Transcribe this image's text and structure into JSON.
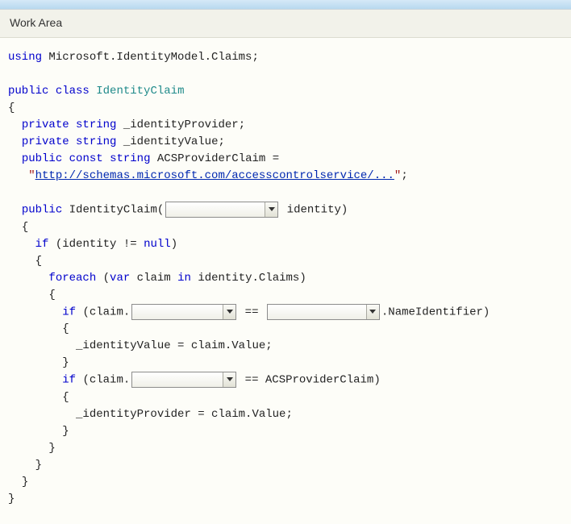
{
  "header": {
    "title": "Work Area"
  },
  "code": {
    "kw_using": "using",
    "ns": "Microsoft.IdentityModel.Claims",
    "kw_public": "public",
    "kw_class": "class",
    "classname": "IdentityClaim",
    "kw_private": "private",
    "kw_string": "string",
    "field1": "_identityProvider",
    "field2": "_identityValue",
    "kw_const": "const",
    "constname": "ACSProviderClaim",
    "consturl": "http://schemas.microsoft.com/accesscontrolservice/...",
    "ctorname": "IdentityClaim",
    "param": "identity",
    "kw_if": "if",
    "kw_null": "null",
    "kw_foreach": "foreach",
    "kw_var": "var",
    "kw_in": "in",
    "loopvar": "claim",
    "loopsrc": "identity.Claims",
    "access1": "claim.",
    "suffix1": ".NameIdentifier",
    "assign1": "_identityValue = claim.Value;",
    "access2": "claim.",
    "suffix2": "ACSProviderClaim",
    "assign2": "_identityProvider = claim.Value;",
    "semicolon": ";",
    "openparen": "(",
    "closeparen": ")",
    "openbrace": "{",
    "closebrace": "}",
    "eq": "=",
    "eqeq": "==",
    "neq": "!=",
    "dq": "\""
  }
}
